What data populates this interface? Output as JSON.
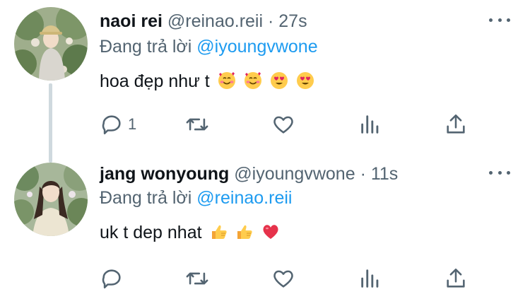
{
  "tweets": [
    {
      "name": "naoi rei",
      "handle": "@reinao.reii",
      "dot": "·",
      "time": "27s",
      "reply_prefix": "Đang trả lời",
      "reply_mention": "@iyoungvwone",
      "text": "hoa đẹp như t",
      "emojis": [
        "smiling-face-with-hearts",
        "smiling-face-with-hearts",
        "heart-eyes",
        "heart-eyes"
      ],
      "reply_count": "1"
    },
    {
      "name": "jang wonyoung",
      "handle": "@iyoungvwone",
      "dot": "·",
      "time": "11s",
      "reply_prefix": "Đang trả lời",
      "reply_mention": "@reinao.reii",
      "text": "uk t dep nhat",
      "emojis": [
        "thumbs-up",
        "thumbs-up",
        "red-heart"
      ],
      "reply_count": ""
    }
  ],
  "colors": {
    "text": "#0f1419",
    "secondary": "#536471",
    "link": "#1d9bf0",
    "thread_line": "#cfd9de"
  }
}
